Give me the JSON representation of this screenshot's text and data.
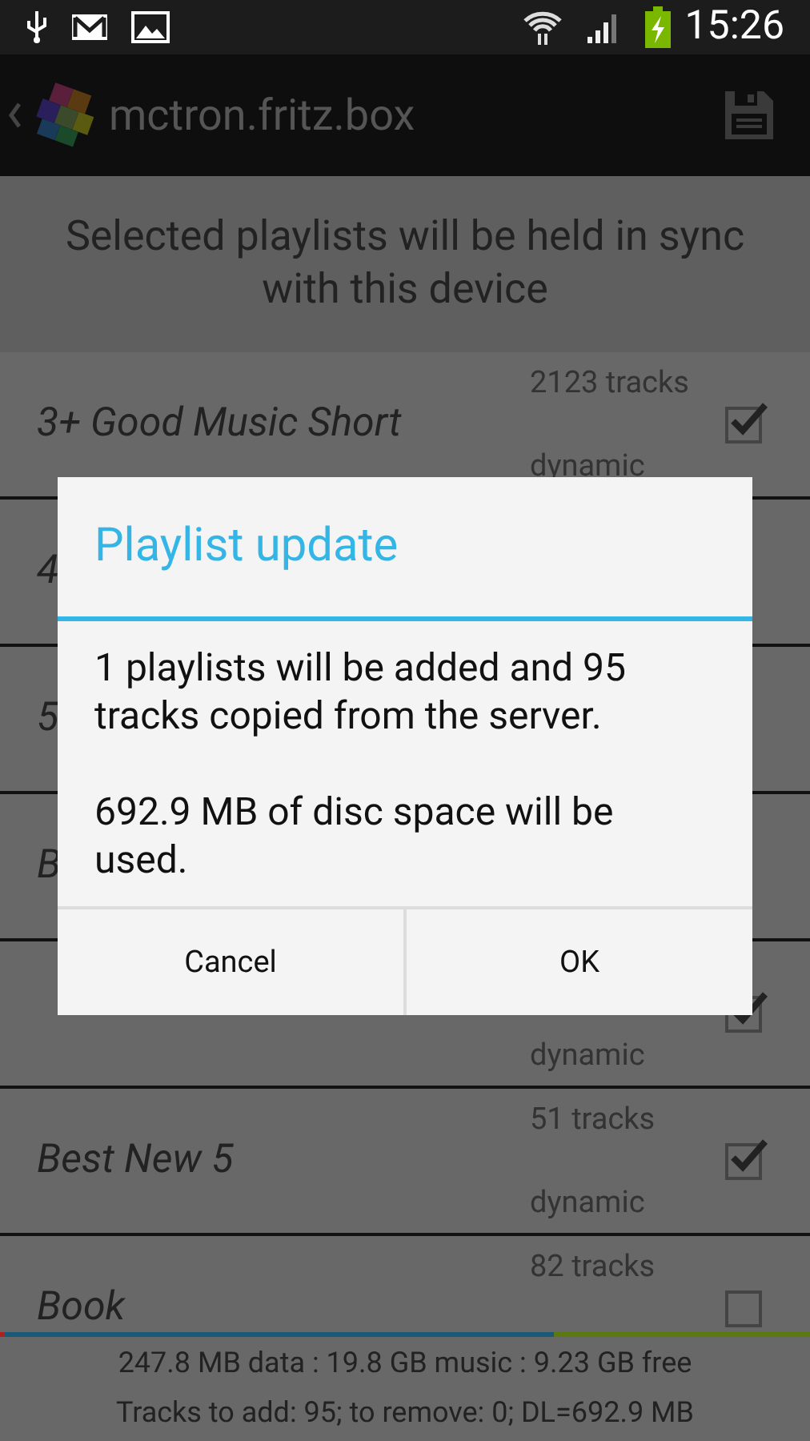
{
  "status_bar": {
    "time": "15:26"
  },
  "action_bar": {
    "title": "mctron.fritz.box"
  },
  "header": "Selected playlists will be held in sync with this device",
  "playlists": [
    {
      "name": "3+ Good Music Short",
      "tracks": "2123 tracks",
      "type": "dynamic",
      "checked": true
    },
    {
      "name": "4"
    },
    {
      "name": "5"
    },
    {
      "name": "B"
    },
    {
      "type": "dynamic",
      "checked": true
    },
    {
      "name": "Best New 5",
      "tracks": "51 tracks",
      "type": "dynamic",
      "checked": true
    },
    {
      "name": "Book",
      "tracks": "82 tracks",
      "checked": false
    }
  ],
  "storage_bar": [
    {
      "color": "#b02020",
      "level": 0.006
    },
    {
      "color": "#1a5a78",
      "level": 0.677
    },
    {
      "color": "#5a7a10",
      "level": 0.317
    }
  ],
  "footer": [
    "247.8 MB data : 19.8 GB music : 9.23 GB free",
    "Tracks to add: 95; to remove: 0; DL=692.9 MB"
  ],
  "dialog": {
    "title": "Playlist update",
    "paragraphs": [
      "1 playlists will be added and 95 tracks copied from the server.",
      "692.9 MB of disc space will be used."
    ],
    "buttons": [
      "Cancel",
      "OK"
    ]
  }
}
